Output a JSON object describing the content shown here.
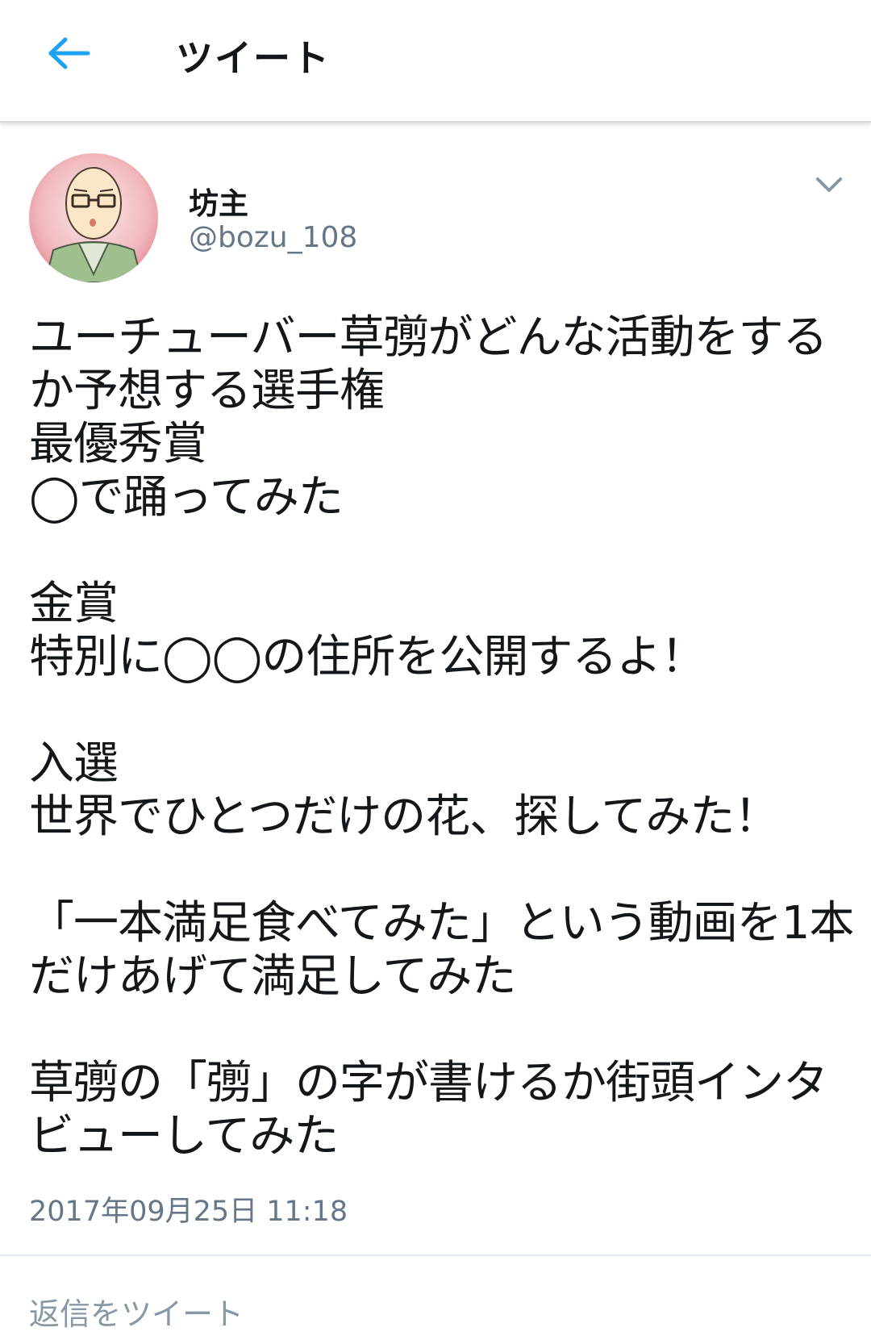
{
  "header": {
    "title": "ツイート",
    "back_icon": "arrow-left-icon",
    "accent_color": "#1da1f2"
  },
  "user": {
    "name": "坊主",
    "handle": "@bozu_108",
    "avatar_icon": "avatar-illustration"
  },
  "tweet": {
    "lines": [
      "ユーチューバー草彅がどんな活動をする",
      "か予想する選手権",
      "最優秀賞",
      "◯で踊ってみた",
      "",
      "金賞",
      "特別に◯◯の住所を公開するよ！",
      "",
      "入選",
      "世界でひとつだけの花、探してみた！",
      "",
      "「一本満足食べてみた」という動画を1本",
      "だけあげて満足してみた",
      "",
      "草彅の「彅」の字が書けるか街頭インタ",
      "ビューしてみた"
    ],
    "timestamp": "2017年09月25日 11:18"
  },
  "reply": {
    "placeholder": "返信をツイート"
  }
}
